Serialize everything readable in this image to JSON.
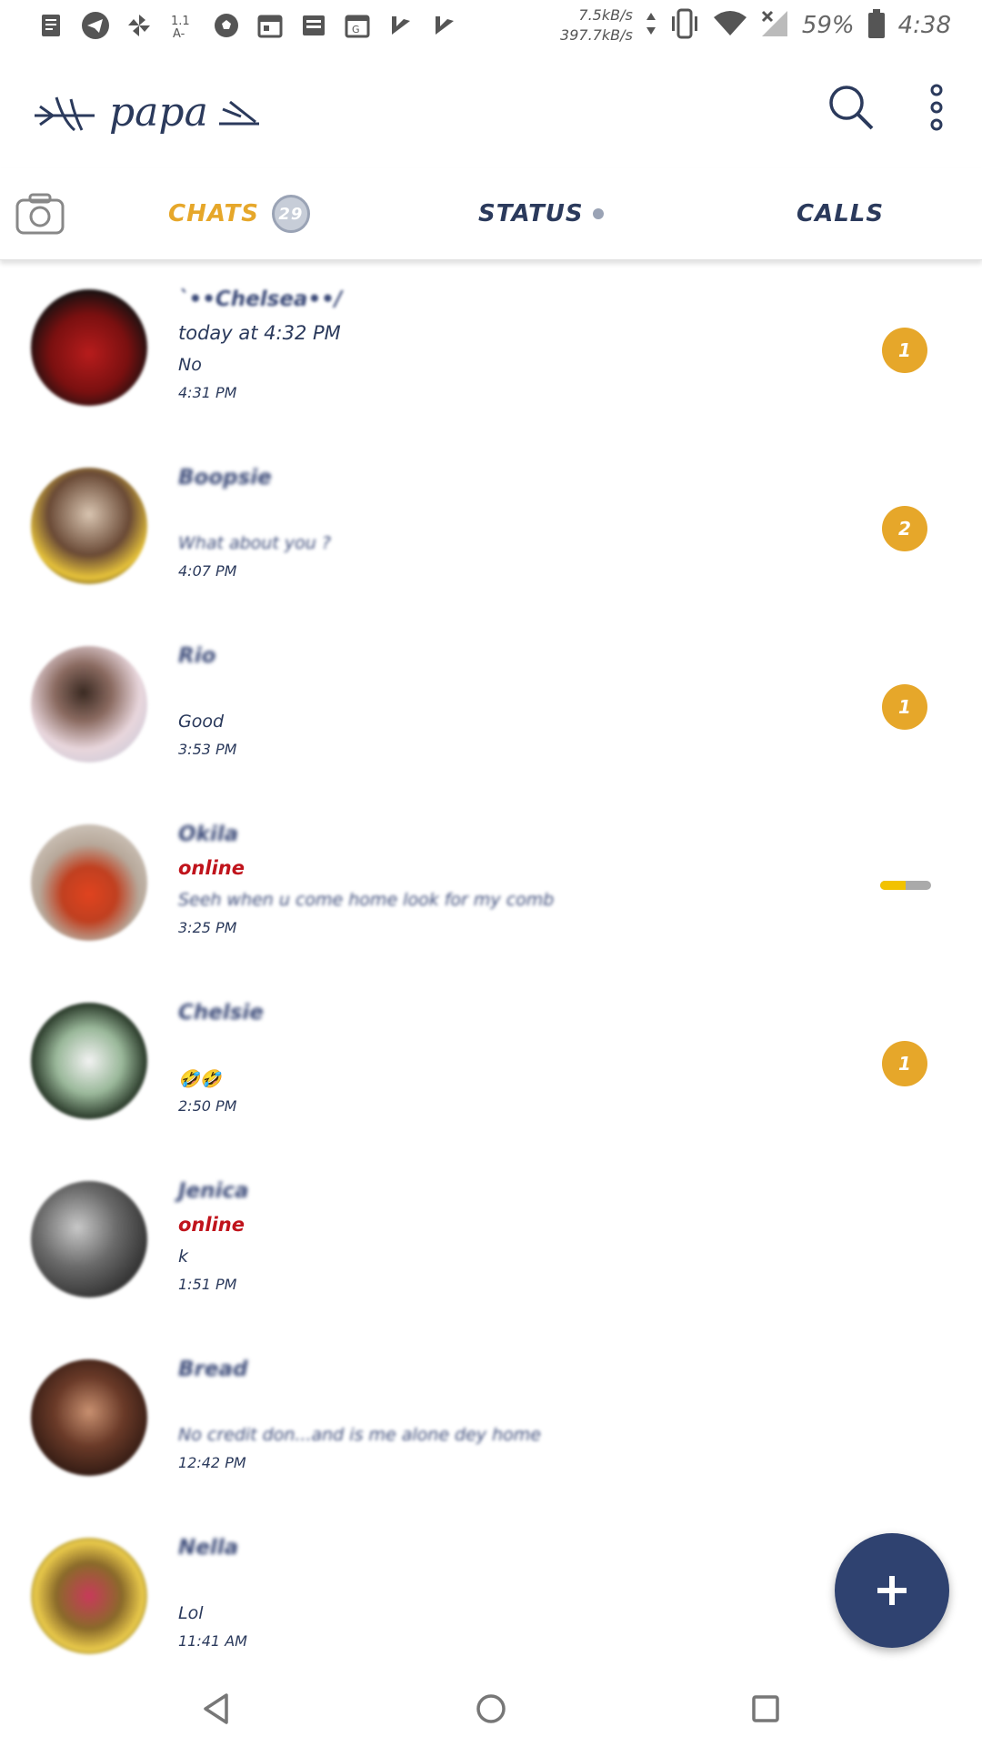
{
  "status_bar": {
    "net_up": "7.5kB/s",
    "net_down": "397.7kB/s",
    "battery": "59%",
    "time": "4:38",
    "icons": [
      "reader-icon",
      "telegram-icon",
      "pinwheel-icon",
      "text-size-icon",
      "soccer-ball-icon",
      "calendar-icon",
      "news-icon",
      "google-calendar-icon",
      "tick-icon",
      "tick-icon",
      "vibrate-icon",
      "wifi-icon",
      "no-signal-icon",
      "battery-icon"
    ]
  },
  "app_bar": {
    "title": "papa",
    "icons": [
      "search-icon",
      "more-vert-icon"
    ]
  },
  "tabs": {
    "chats_label": "CHATS",
    "chats_count": "29",
    "status_label": "STATUS",
    "calls_label": "CALLS"
  },
  "chats": [
    {
      "name": "`••Chelsea••/",
      "sub": "today at 4:32 PM",
      "message": "No",
      "time": "4:31 PM",
      "unread": "1",
      "avatar_color": "#7a1010"
    },
    {
      "name": "Boopsie",
      "sub": "",
      "message": "What about you ?",
      "time": "4:07 PM",
      "unread": "2",
      "avatar_color": "#5a4030"
    },
    {
      "name": "Rio",
      "sub": "",
      "message": "Good",
      "time": "3:53 PM",
      "unread": "1",
      "avatar_color": "#c8b8b4"
    },
    {
      "name": "Okila",
      "sub": "online",
      "message": "Seeh when u come home look for my comb",
      "time": "3:25 PM",
      "unread": "",
      "typing_progress": 0.5,
      "avatar_color": "#b7a89a"
    },
    {
      "name": "Chelsie",
      "sub": "",
      "message": "🤣🤣",
      "time": "2:50 PM",
      "unread": "1",
      "avatar_color": "#2a3a2a"
    },
    {
      "name": "Jenica",
      "sub": "online",
      "message": "k",
      "time": "1:51 PM",
      "unread": "",
      "avatar_color": "#555555"
    },
    {
      "name": "Bread",
      "sub": "",
      "message": "No credit don...and is me alone dey home",
      "time": "12:42 PM",
      "unread": "",
      "avatar_color": "#3a2218"
    },
    {
      "name": "Nella",
      "sub": "",
      "message": "Lol",
      "time": "11:41 AM",
      "unread": "",
      "avatar_color": "#6b6a2a"
    }
  ],
  "fab": {
    "icon": "plus-icon"
  },
  "nav": {
    "icons": [
      "back-icon",
      "home-icon",
      "recents-icon"
    ]
  },
  "colors": {
    "accent": "#e6a72a",
    "primary": "#2f4270",
    "online": "#c0141c"
  }
}
